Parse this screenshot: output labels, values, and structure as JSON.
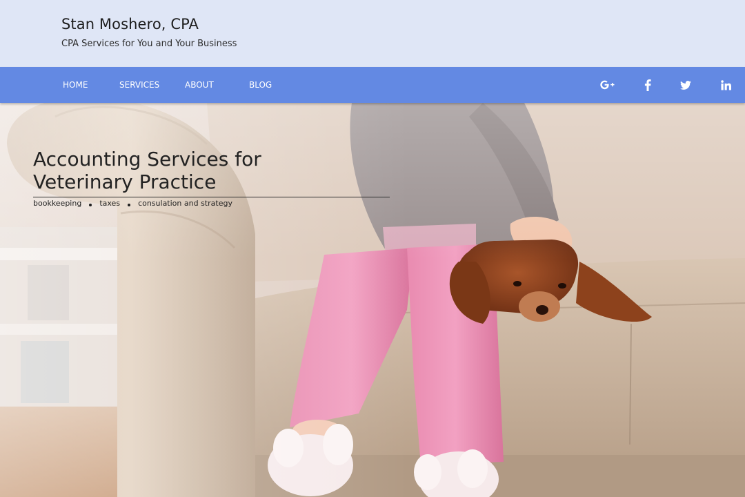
{
  "header": {
    "site_title": "Stan Moshero, CPA",
    "tagline": "CPA Services for You and Your Business"
  },
  "nav": {
    "items": [
      {
        "label": "HOME"
      },
      {
        "label": "SERVICES"
      },
      {
        "label": "ABOUT"
      },
      {
        "label": "BLOG"
      }
    ],
    "social": [
      {
        "icon": "google-plus-icon"
      },
      {
        "icon": "facebook-icon"
      },
      {
        "icon": "twitter-icon"
      },
      {
        "icon": "linkedin-icon"
      }
    ]
  },
  "hero": {
    "heading_line1": "Accounting Services for",
    "heading_line2": "Veterinary Practice",
    "services": [
      "bookkeeping",
      "taxes",
      "consulation and strategy"
    ]
  },
  "colors": {
    "header_bg": "#dfe6f6",
    "nav_bg": "#6389e3",
    "nav_text": "#ffffff",
    "heading_text": "#222222"
  }
}
